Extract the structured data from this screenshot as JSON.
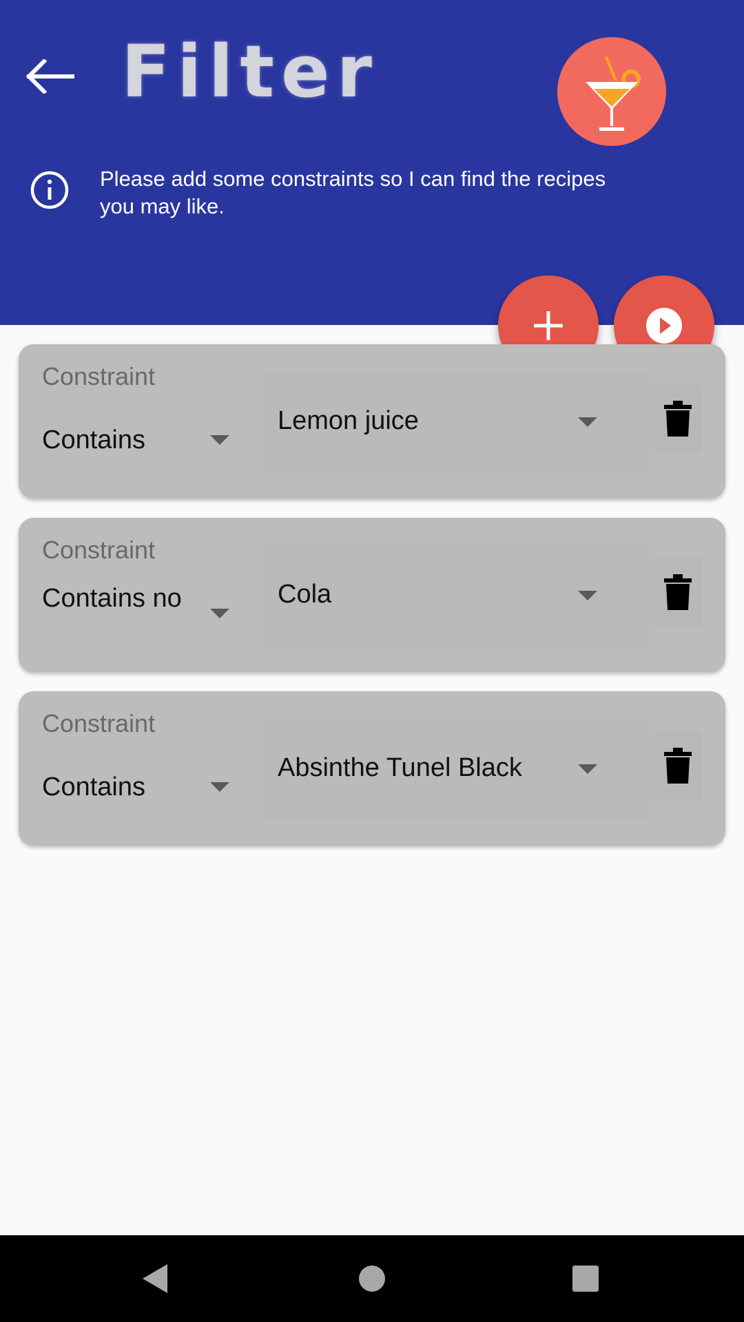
{
  "header": {
    "title": "Filter",
    "back_icon": "arrow-left-icon",
    "logo_icon": "cocktail-icon",
    "info_icon": "info-icon",
    "info_text": "Please add some constraints so I can find the recipes you may like.",
    "color": "#2a36a0"
  },
  "fabs": {
    "add_icon": "plus-icon",
    "run_icon": "play-circle-icon",
    "color": "#e4554a"
  },
  "constraints": [
    {
      "label": "Constraint",
      "operator": "Contains",
      "ingredient": "Lemon juice"
    },
    {
      "label": "Constraint",
      "operator": "Contains no",
      "ingredient": "Cola"
    },
    {
      "label": "Constraint",
      "operator": "Contains",
      "ingredient": "Absinthe Tunel Black"
    }
  ],
  "navbar": {
    "back_icon": "nav-back-icon",
    "home_icon": "nav-home-icon",
    "recents_icon": "nav-recents-icon"
  }
}
